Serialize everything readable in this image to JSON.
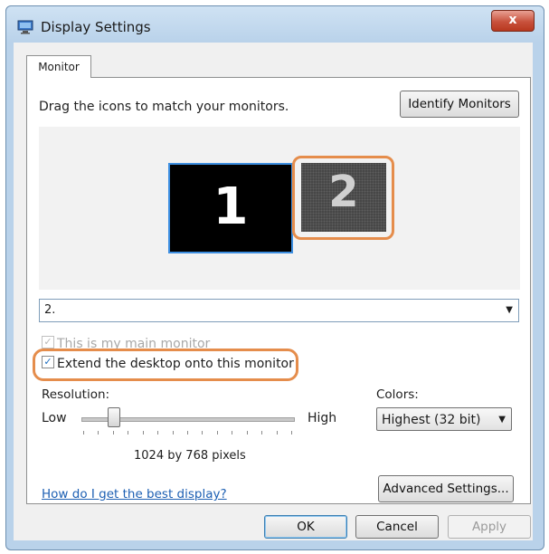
{
  "window": {
    "title": "Display Settings",
    "close_label": "x"
  },
  "tabs": [
    {
      "label": "Monitor",
      "selected": true
    }
  ],
  "monitor_tab": {
    "instruction": "Drag the icons to match your monitors.",
    "identify_button": "Identify Monitors",
    "monitors": [
      {
        "number": "1",
        "selected": true
      },
      {
        "number": "2",
        "selected": false,
        "highlighted": true
      }
    ],
    "monitor_select": {
      "value": "2."
    },
    "main_monitor_checkbox": {
      "label": "This is my main monitor",
      "checked": true,
      "disabled": true
    },
    "extend_checkbox": {
      "label": "Extend the desktop onto this monitor",
      "checked": true,
      "highlighted": true
    },
    "resolution": {
      "label": "Resolution:",
      "low_label": "Low",
      "high_label": "High",
      "value_text": "1024 by 768 pixels",
      "slider_fraction": 0.15,
      "tick_count": 15
    },
    "colors": {
      "label": "Colors:",
      "value": "Highest (32 bit)"
    },
    "help_link": "How do I get the best display?",
    "advanced_button": "Advanced Settings..."
  },
  "footer": {
    "ok_label": "OK",
    "cancel_label": "Cancel",
    "apply_label": "Apply"
  },
  "colors_theme": {
    "highlight": "#e58d4c",
    "selection": "#3d8ee0",
    "link": "#1c5fb3"
  }
}
